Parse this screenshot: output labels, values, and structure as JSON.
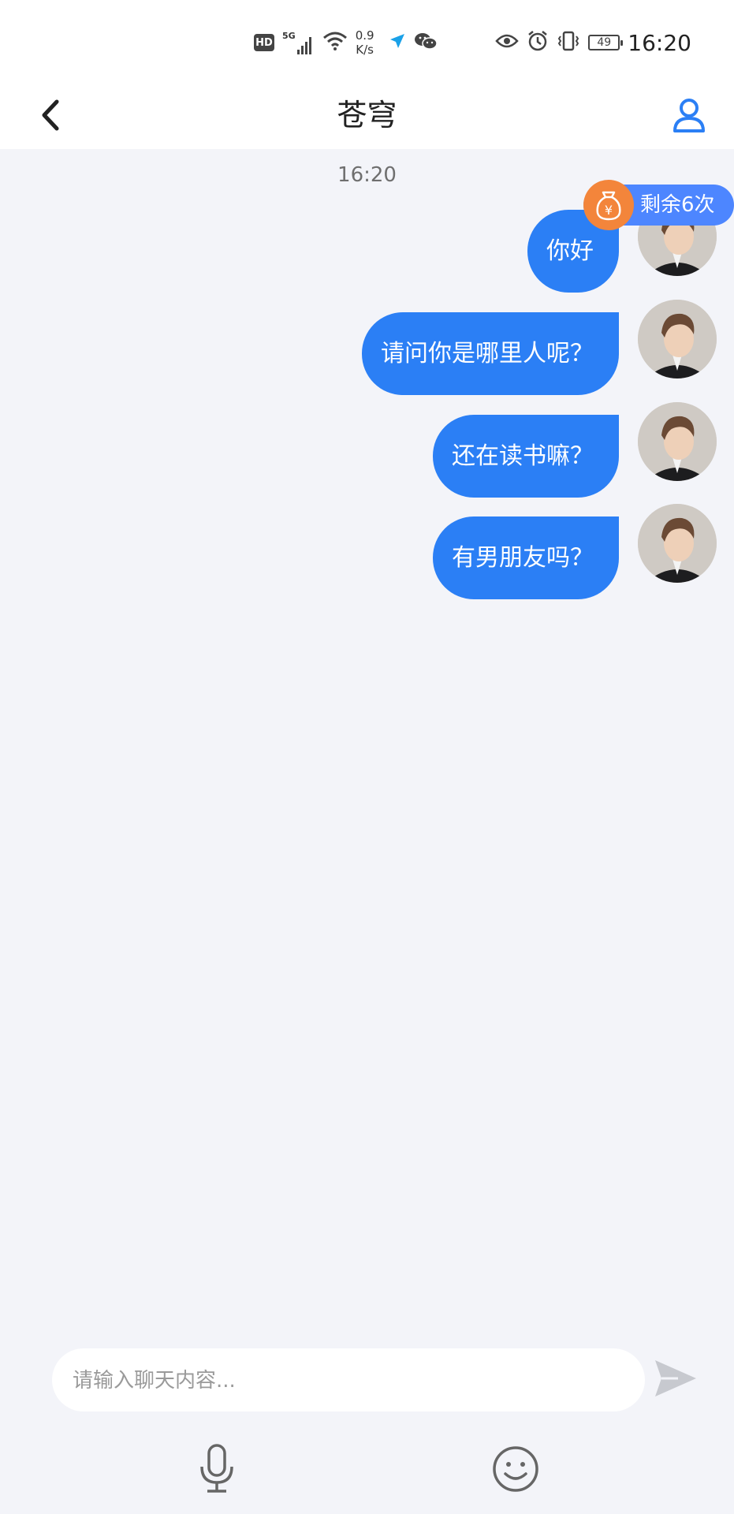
{
  "status_bar": {
    "hd": "HD",
    "signal": "5G",
    "net_speed_value": "0.9",
    "net_speed_unit": "K/s",
    "battery": "49",
    "time": "16:20"
  },
  "header": {
    "title": "苍穹"
  },
  "chat": {
    "timestamp": "16:20",
    "remaining": "剩余6次",
    "messages": [
      {
        "text": "你好"
      },
      {
        "text": "请问你是哪里人呢？"
      },
      {
        "text": "还在读书嘛？"
      },
      {
        "text": "有男朋友吗？"
      }
    ]
  },
  "composer": {
    "placeholder": "请输入聊天内容..."
  },
  "colors": {
    "bubble": "#2b7ff5",
    "accent_blue": "#4d86ff",
    "coin_orange": "#f3853b",
    "background": "#f3f4f9"
  }
}
